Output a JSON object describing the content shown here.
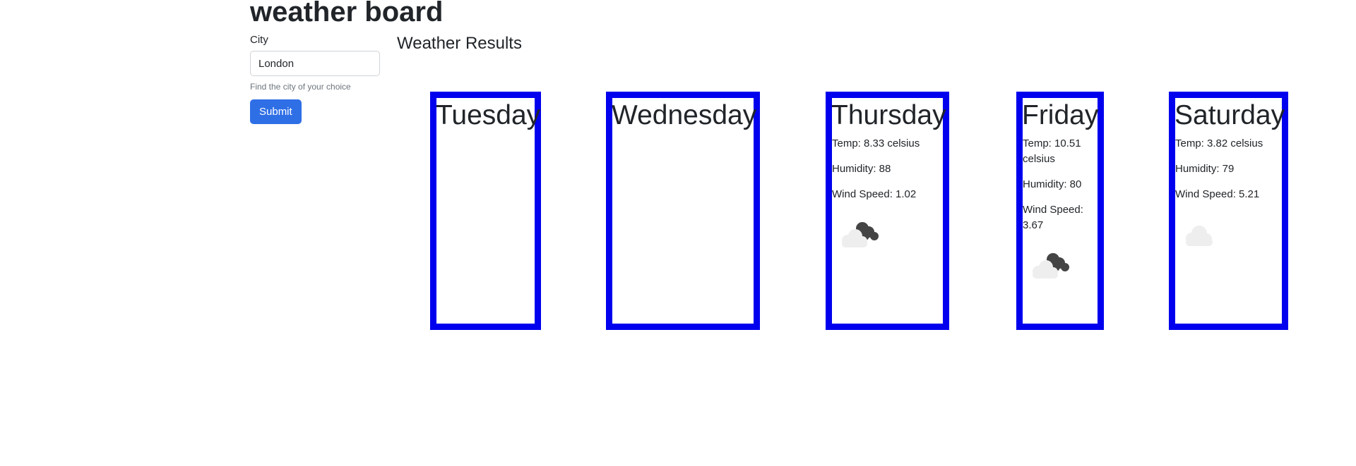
{
  "header": {
    "title": "weather board"
  },
  "form": {
    "city_label": "City",
    "city_value": "London",
    "help_text": "Find the city of your choice",
    "submit_label": "Submit"
  },
  "results": {
    "heading": "Weather Results",
    "days": [
      {
        "name": "Tuesday"
      },
      {
        "name": "Wednesday"
      },
      {
        "name": "Thursday",
        "temp": "Temp: 8.33 celsius",
        "humidity": "Humidity: 88",
        "wind": "Wind Speed: 1.02",
        "icon": "broken-clouds-icon"
      },
      {
        "name": "Friday",
        "temp": "Temp: 10.51 celsius",
        "humidity": "Humidity: 80",
        "wind": "Wind Speed: 3.67",
        "icon": "broken-clouds-icon"
      },
      {
        "name": "Saturday",
        "temp": "Temp: 3.82 celsius",
        "humidity": "Humidity: 79",
        "wind": "Wind Speed: 5.21",
        "icon": "cloud-icon"
      }
    ]
  },
  "colors": {
    "card_border": "#0000ee",
    "button": "#2f6fe6"
  }
}
